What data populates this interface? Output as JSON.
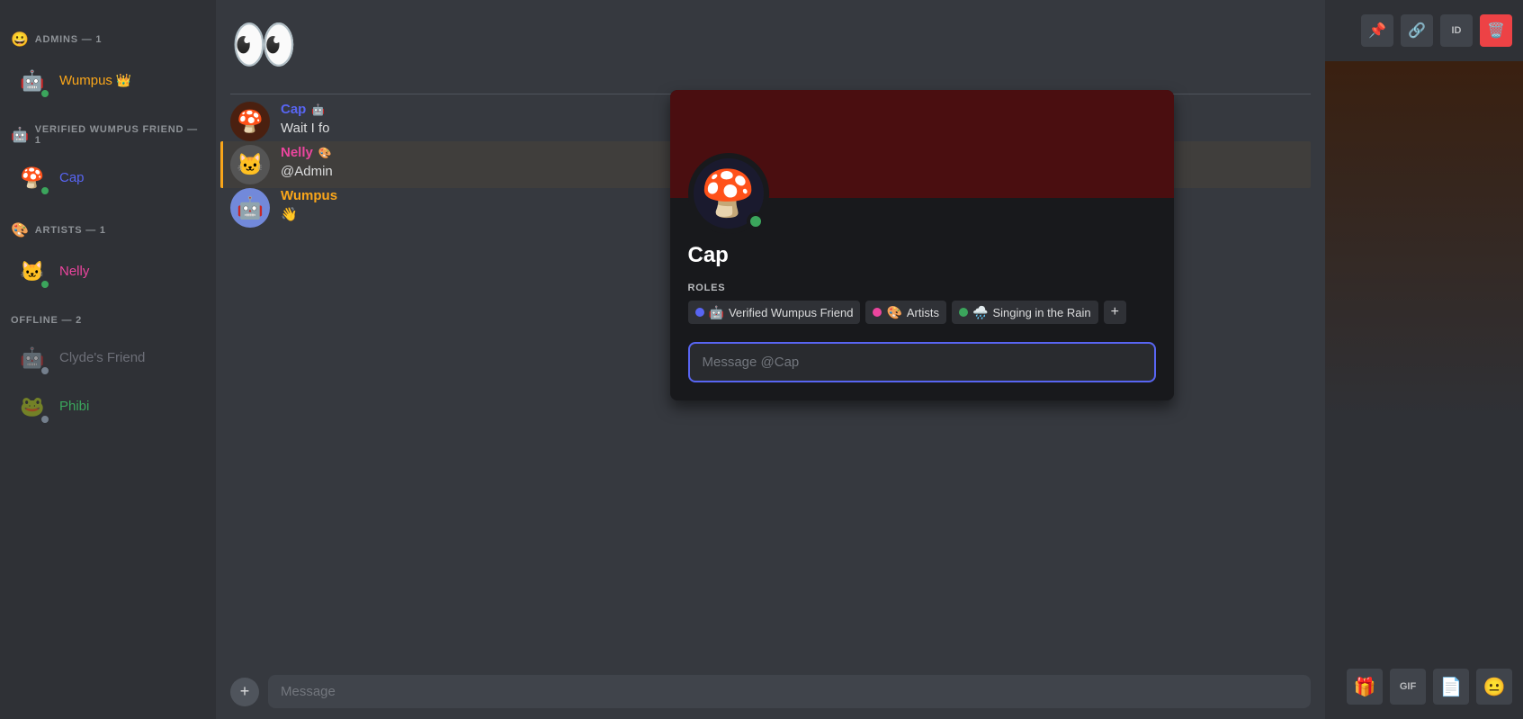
{
  "sidebar": {
    "sections": [
      {
        "id": "admins",
        "label": "ADMINS — 1",
        "icon": "😀",
        "members": [
          {
            "id": "wumpus",
            "name": "Wumpus",
            "nameColor": "admin-color",
            "status": "online",
            "badge": "👑",
            "emoji": "🤖"
          }
        ]
      },
      {
        "id": "verified",
        "label": "VERIFIED WUMPUS FRIEND — 1",
        "icon": "🤖",
        "members": [
          {
            "id": "cap",
            "name": "Cap",
            "nameColor": "verified-color",
            "status": "online",
            "badge": "",
            "emoji": "🍄"
          }
        ]
      },
      {
        "id": "artists",
        "label": "ARTISTS — 1",
        "icon": "🎨",
        "members": [
          {
            "id": "nelly",
            "name": "Nelly",
            "nameColor": "artist-color",
            "status": "online",
            "badge": "",
            "emoji": "🐱"
          }
        ]
      },
      {
        "id": "offline",
        "label": "OFFLINE — 2",
        "icon": "",
        "members": [
          {
            "id": "clydes-friend",
            "name": "Clyde's Friend",
            "nameColor": "offline-color",
            "status": "offline",
            "badge": "",
            "emoji": "🤖"
          },
          {
            "id": "phibi",
            "name": "Phibi",
            "nameColor": "green-color",
            "status": "offline",
            "badge": "",
            "emoji": "🐸"
          }
        ]
      }
    ]
  },
  "chat": {
    "messages": [
      {
        "id": "msg1",
        "author": "Cap",
        "authorColor": "#5865f2",
        "badge": "🤖",
        "text": "Wait I fo",
        "emoji": "🍄",
        "avatarBg": "#4a2010"
      },
      {
        "id": "msg2",
        "author": "Nelly",
        "authorColor": "#eb459e",
        "badge": "🎨",
        "text": "@Admin",
        "emoji": "🐱",
        "avatarBg": "#555",
        "highlighted": true
      },
      {
        "id": "msg3",
        "author": "Wumpus",
        "authorColor": "#faa61a",
        "badge": "",
        "text": "👋",
        "emoji": "🤖",
        "avatarBg": "#7289da"
      }
    ],
    "topEmojis": "👀",
    "inputPlaceholder": "Message"
  },
  "profile": {
    "name": "Cap",
    "rolesLabel": "ROLES",
    "roles": [
      {
        "id": "verified-wumpus-friend",
        "color": "#5865f2",
        "icon": "🤖",
        "label": "Verified Wumpus Friend"
      },
      {
        "id": "artists",
        "color": "#eb459e",
        "icon": "🎨",
        "label": "Artists"
      },
      {
        "id": "singing-in-rain",
        "color": "#3ba55c",
        "icon": "🌧️",
        "label": "Singing in the Rain"
      }
    ],
    "messageInputPlaceholder": "Message @Cap",
    "status": "online",
    "bannerBg": "#4a0e10",
    "avatarEmoji": "🍄"
  },
  "rightPanel": {
    "actions": [
      {
        "id": "pin",
        "icon": "📌",
        "label": "pin-button"
      },
      {
        "id": "link",
        "icon": "🔗",
        "label": "link-button"
      },
      {
        "id": "id-btn",
        "icon": "ID",
        "label": "id-button",
        "text": true
      },
      {
        "id": "delete",
        "icon": "🗑️",
        "label": "delete-button",
        "red": true
      }
    ],
    "bottomActions": [
      {
        "id": "gift",
        "icon": "🎁",
        "label": "gift-button"
      },
      {
        "id": "gif",
        "icon": "GIF",
        "label": "gif-button",
        "text": true
      },
      {
        "id": "sticker",
        "icon": "📄",
        "label": "sticker-button"
      },
      {
        "id": "emoji",
        "icon": "😐",
        "label": "emoji-button"
      }
    ]
  }
}
